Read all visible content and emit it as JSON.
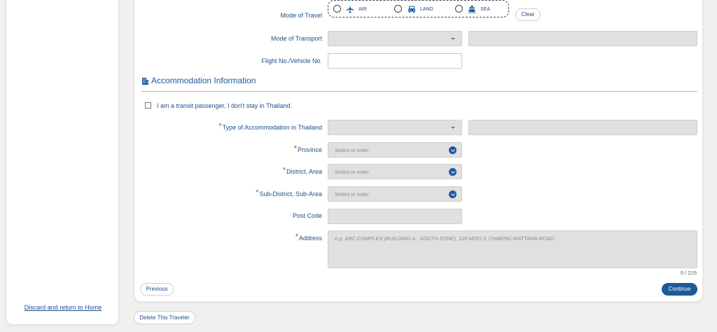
{
  "sidebar": {
    "discard_link": "Discard and return to Home"
  },
  "travel": {
    "mode_of_travel_label": "Mode of Travel",
    "options": [
      {
        "label": "AIR",
        "icon": "plane-icon"
      },
      {
        "label": "LAND",
        "icon": "car-icon"
      },
      {
        "label": "SEA",
        "icon": "ship-icon"
      }
    ],
    "clear_label": "Clear",
    "mode_of_transport_label": "Mode of Transport",
    "mode_of_transport_value": "",
    "mode_of_transport_other": "",
    "flight_label": "Flight No./Vehicle No.",
    "flight_value": ""
  },
  "accommodation": {
    "section_icon": "building-icon",
    "section_title": "Accommodation Information",
    "transit_label": "I am a transit passenger, I don't stay in Thailand.",
    "transit_checked": false,
    "type_label": "Type of Accommodation in Thailand",
    "province_label": "Province",
    "province_placeholder": "Select or enter",
    "district_label": "District, Area",
    "district_placeholder": "Select or enter",
    "subdistrict_label": "Sub-District, Sub-Area",
    "subdistrict_placeholder": "Select or enter",
    "postcode_label": "Post Code",
    "address_label": "Address",
    "address_placeholder": "e.g. ABC COMPLEX (BUILDING A . SOUTH ZONE), 120 MOO 3, CHAENG WATTANA ROAD",
    "address_counter": "0 / 215",
    "required_mark": "*"
  },
  "navigation": {
    "previous_label": "Previous",
    "continue_label": "Continue",
    "delete_label": "Delete This Traveler"
  },
  "colors": {
    "primary": "#1c5a9a",
    "label_text": "#1f4f86",
    "required": "#d9363e"
  }
}
